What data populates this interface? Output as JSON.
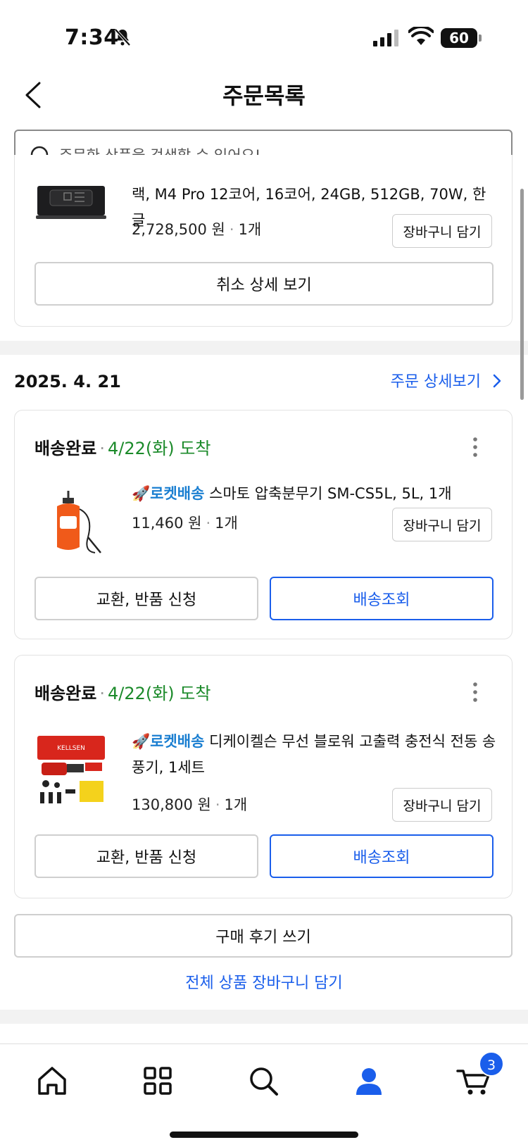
{
  "status": {
    "time": "7:34",
    "battery": "60"
  },
  "header": {
    "title": "주문목록"
  },
  "search": {
    "placeholder": "주문한 상품을 검색할 수 있어요!"
  },
  "partial_order": {
    "product_text": "랙, M4 Pro 12코어, 16코어, 24GB, 512GB, 70W, 한글",
    "price": "2,728,500 원",
    "qty": "1개",
    "cart_label": "장바구니 담기",
    "cancel_detail_label": "취소 상세 보기"
  },
  "order_group": {
    "date": "2025. 4. 21",
    "detail_link": "주문 상세보기",
    "items": [
      {
        "status": "배송완료",
        "arrival": "4/22(화) 도착",
        "badge": "로켓배송",
        "name": "스마토 압축분무기 SM-CS5L, 5L, 1개",
        "price": "11,460 원",
        "qty": "1개",
        "cart_label": "장바구니 담기",
        "exchange_label": "교환, 반품 신청",
        "track_label": "배송조회"
      },
      {
        "status": "배송완료",
        "arrival": "4/22(화) 도착",
        "badge": "로켓배송",
        "name": "디케이켈슨 무선 블로워 고출력 충전식 전동 송풍기, 1세트",
        "price": "130,800 원",
        "qty": "1개",
        "cart_label": "장바구니 담기",
        "exchange_label": "교환, 반품 신청",
        "track_label": "배송조회"
      }
    ],
    "review_label": "구매 후기 쓰기",
    "all_cart_label": "전체 상품 장바구니 담기"
  },
  "product_images": {
    "item2_brand": "KELLSEN"
  },
  "tab_bar": {
    "icons": [
      "home-icon",
      "categories-icon",
      "search-icon",
      "my-page-icon",
      "cart-icon"
    ],
    "cart_badge": "3",
    "active_color": "#1a5eeb"
  }
}
